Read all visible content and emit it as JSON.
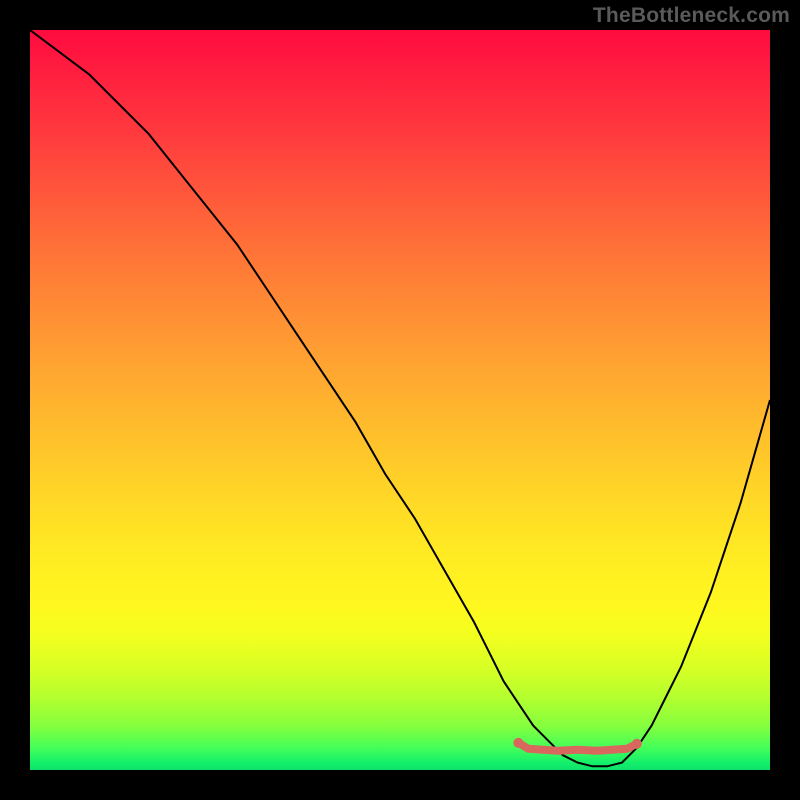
{
  "watermark": "TheBottleneck.com",
  "chart_data": {
    "type": "line",
    "title": "",
    "xlabel": "",
    "ylabel": "",
    "xlim": [
      0,
      100
    ],
    "ylim": [
      0,
      100
    ],
    "grid": false,
    "series": [
      {
        "name": "bottleneck-curve",
        "x": [
          0,
          4,
          8,
          12,
          16,
          20,
          24,
          28,
          32,
          36,
          40,
          44,
          48,
          52,
          56,
          60,
          62,
          64,
          66,
          68,
          70,
          72,
          74,
          76,
          78,
          80,
          82,
          84,
          86,
          88,
          90,
          92,
          94,
          96,
          98,
          100
        ],
        "values": [
          100,
          97,
          94,
          90,
          86,
          81,
          76,
          71,
          65,
          59,
          53,
          47,
          40,
          34,
          27,
          20,
          16,
          12,
          9,
          6,
          4,
          2,
          1,
          0.5,
          0.5,
          1,
          3,
          6,
          10,
          14,
          19,
          24,
          30,
          36,
          43,
          50
        ]
      }
    ],
    "optimal_range": {
      "x_start": 66,
      "x_end": 82,
      "y_level_percent": 97
    },
    "colors": {
      "curve": "#000000",
      "highlight": "#d8675e",
      "gradient_top": "#ff0b3f",
      "gradient_bottom": "#0fe06c"
    }
  }
}
